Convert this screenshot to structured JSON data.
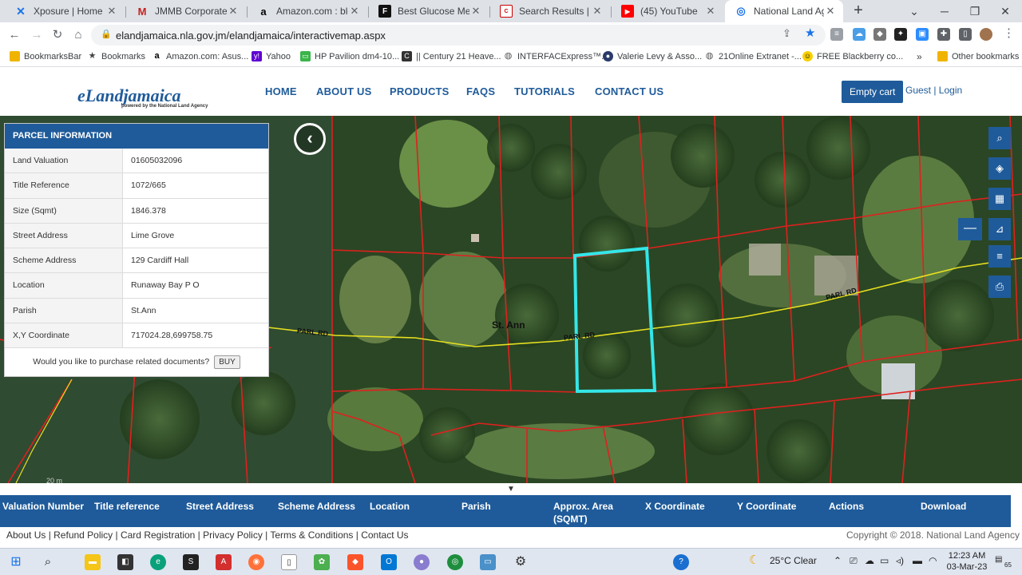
{
  "browser": {
    "tabs": [
      {
        "title": "Xposure | Home",
        "active": false
      },
      {
        "title": "JMMB Corporate Mon",
        "active": false
      },
      {
        "title": "Amazon.com : blood",
        "active": false
      },
      {
        "title": "Best Glucose Meters",
        "active": false
      },
      {
        "title": "Search Results | Canon",
        "active": false
      },
      {
        "title": "(45) YouTube",
        "active": false
      },
      {
        "title": "National Land Agency",
        "active": true
      }
    ],
    "url": "elandjamaica.nla.gov.jm/elandjamaica/interactivemap.aspx",
    "bookmarks": [
      "BookmarksBar",
      "Bookmarks",
      "Amazon.com: Asus...",
      "Yahoo",
      "HP Pavilion dm4-10...",
      "|| Century 21 Heave...",
      "INTERFACExpress™...",
      "Valerie Levy & Asso...",
      "21Online Extranet -...",
      "FREE Blackberry co...",
      "Other bookmarks"
    ]
  },
  "site": {
    "logo": "eLandjamaica",
    "logo_sub": "powered by the National Land Agency",
    "nav": [
      "HOME",
      "ABOUT US",
      "PRODUCTS",
      "FAQS",
      "TUTORIALS",
      "CONTACT US"
    ],
    "cart": "Empty cart",
    "guest": "Guest | Login"
  },
  "parcel": {
    "heading": "PARCEL INFORMATION",
    "rows": [
      {
        "label": "Land Valuation",
        "value": "01605032096"
      },
      {
        "label": "Title Reference",
        "value": "1072/665"
      },
      {
        "label": "Size (Sqmt)",
        "value": "1846.378"
      },
      {
        "label": "Street Address",
        "value": "Lime Grove"
      },
      {
        "label": "Scheme Address",
        "value": "129 Cardiff Hall"
      },
      {
        "label": "Location",
        "value": "Runaway Bay P O"
      },
      {
        "label": "Parish",
        "value": "St.Ann"
      },
      {
        "label": "X,Y Coordinate",
        "value": "717024.28,699758.75"
      }
    ],
    "buy_prompt": "Would you like to purchase related documents?",
    "buy_label": "BUY"
  },
  "map": {
    "parish_label": "St. Ann",
    "road_label": "PARL RD",
    "scale_label": "20 m",
    "colors": {
      "parcel_lines": "#e0201f",
      "road": "#e8e020",
      "selected": "#34e6e8"
    }
  },
  "results": {
    "columns": [
      "Valuation Number",
      "Title reference",
      "Street Address",
      "Scheme Address",
      "Location",
      "Parish",
      "Approx. Area (SQMT)",
      "X Coordinate",
      "Y Coordinate",
      "Actions",
      "Download"
    ]
  },
  "footer": {
    "links": "About Us | Refund Policy | Card Registration | Privacy Policy | Terms & Conditions | Contact Us",
    "copyright": "Copyright © 2018. National Land Agency"
  },
  "taskbar": {
    "weather": "25°C Clear",
    "time": "12:23 AM",
    "date": "03-Mar-23",
    "notifications": "65"
  }
}
